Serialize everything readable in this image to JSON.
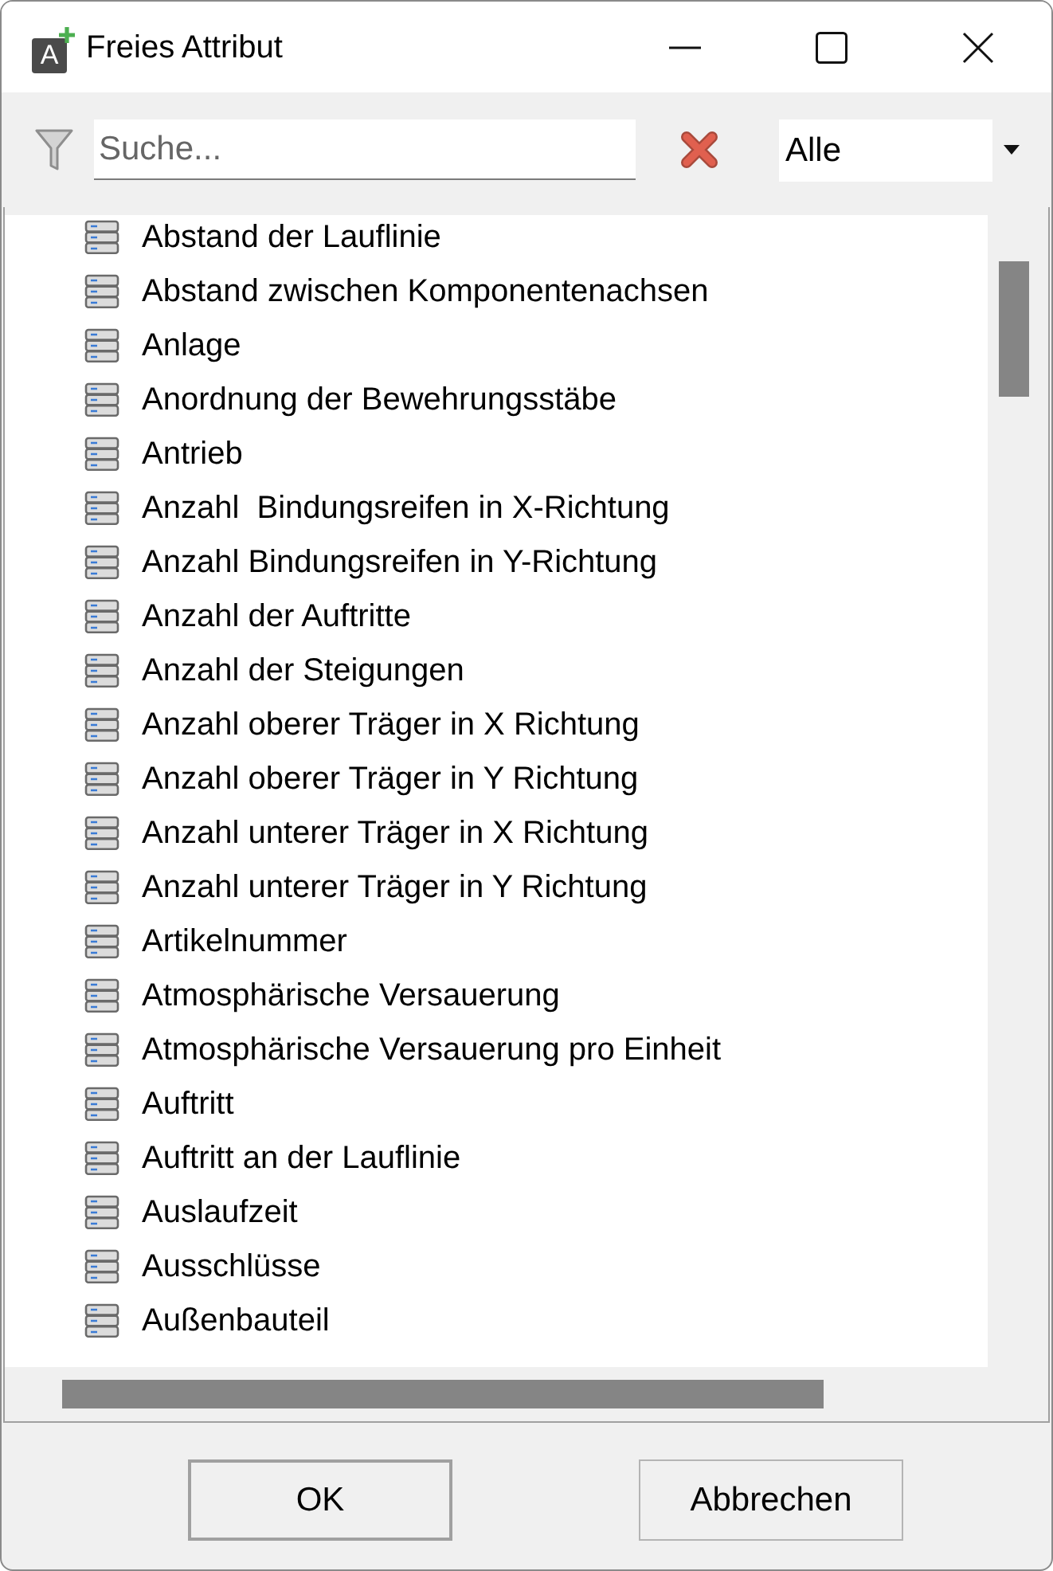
{
  "window": {
    "title": "Freies Attribut",
    "icon_letter": "A"
  },
  "toolbar": {
    "search": {
      "placeholder": "Suche..."
    },
    "category": {
      "value": "Alle"
    }
  },
  "list": {
    "items": [
      {
        "label": "Abstand der Lauflinie"
      },
      {
        "label": "Abstand zwischen Komponentenachsen"
      },
      {
        "label": "Anlage"
      },
      {
        "label": "Anordnung der Bewehrungsstäbe"
      },
      {
        "label": "Antrieb"
      },
      {
        "label": "Anzahl  Bindungsreifen in X-Richtung"
      },
      {
        "label": "Anzahl Bindungsreifen in Y-Richtung"
      },
      {
        "label": "Anzahl der Auftritte"
      },
      {
        "label": "Anzahl der Steigungen"
      },
      {
        "label": "Anzahl oberer Träger in X Richtung"
      },
      {
        "label": "Anzahl oberer Träger in Y Richtung"
      },
      {
        "label": "Anzahl unterer Träger in X Richtung"
      },
      {
        "label": "Anzahl unterer Träger in Y Richtung"
      },
      {
        "label": "Artikelnummer"
      },
      {
        "label": "Atmosphärische Versauerung"
      },
      {
        "label": "Atmosphärische Versauerung pro Einheit"
      },
      {
        "label": "Auftritt"
      },
      {
        "label": "Auftritt an der Lauflinie"
      },
      {
        "label": "Auslaufzeit"
      },
      {
        "label": "Ausschlüsse"
      },
      {
        "label": "Außenbauteil"
      }
    ]
  },
  "buttons": [
    {
      "label": "OK",
      "default": true
    },
    {
      "label": "Abbrechen",
      "default": false
    }
  ]
}
